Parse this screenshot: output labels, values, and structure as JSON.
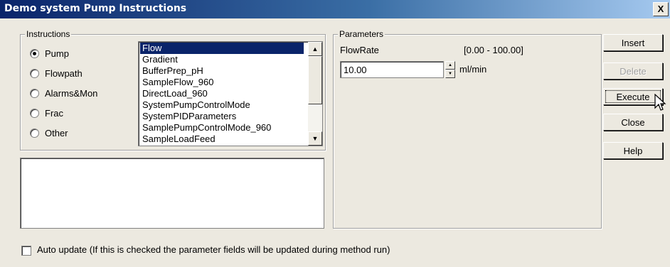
{
  "window": {
    "title": "Demo system Pump Instructions",
    "close_label": "X"
  },
  "instructions": {
    "legend": "Instructions",
    "radios": [
      {
        "label": "Pump",
        "checked": true
      },
      {
        "label": "Flowpath",
        "checked": false
      },
      {
        "label": "Alarms&Mon",
        "checked": false
      },
      {
        "label": "Frac",
        "checked": false
      },
      {
        "label": "Other",
        "checked": false
      }
    ],
    "list": [
      "Flow",
      "Gradient",
      "BufferPrep_pH",
      "SampleFlow_960",
      "DirectLoad_960",
      "SystemPumpControlMode",
      "SystemPIDParameters",
      "SamplePumpControlMode_960",
      "SampleLoadFeed"
    ],
    "selected": "Flow"
  },
  "parameters": {
    "legend": "Parameters",
    "name": "FlowRate",
    "range": "[0.00 - 100.00]",
    "value": "10.00",
    "unit": "ml/min"
  },
  "buttons": {
    "insert": "Insert",
    "delete": "Delete",
    "execute": "Execute",
    "close": "Close",
    "help": "Help"
  },
  "auto_update": {
    "label": "Auto update (If this is checked the parameter fields will be updated during method run)",
    "checked": false
  }
}
